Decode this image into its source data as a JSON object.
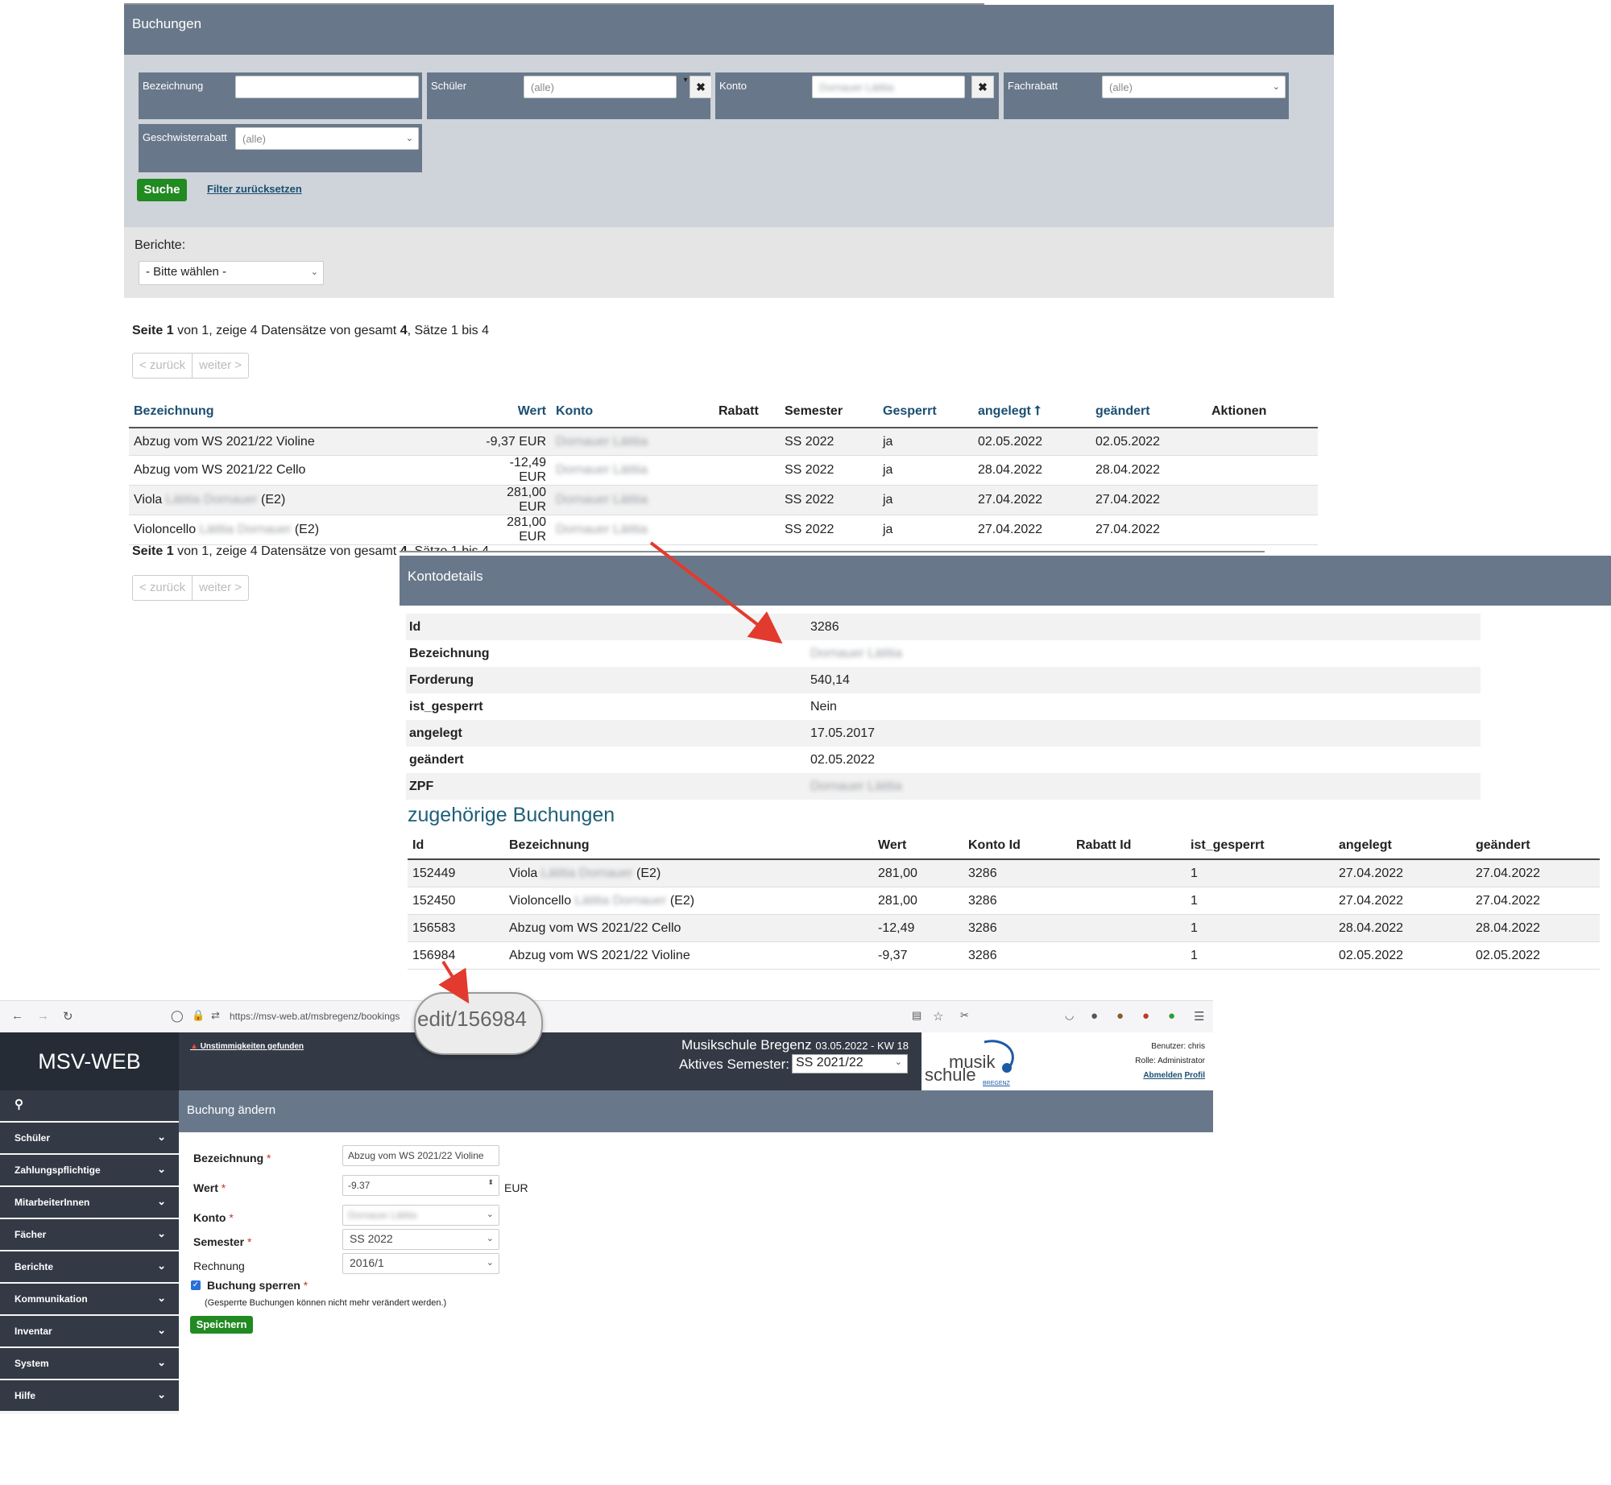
{
  "buchungen": {
    "title": "Buchungen",
    "filters": {
      "bezeichnung_label": "Bezeichnung",
      "schueler_label": "Schüler",
      "schueler_value": "(alle)",
      "konto_label": "Konto",
      "konto_value": "Dornauer Lätitia",
      "fachrabatt_label": "Fachrabatt",
      "fachrabatt_value": "(alle)",
      "geschwisterrabatt_label": "Geschwisterrabatt",
      "geschwisterrabatt_value": "(alle)",
      "search_button": "Suche",
      "reset_link": "Filter zurücksetzen"
    },
    "reports": {
      "label": "Berichte:",
      "select_value": "- Bitte wählen -"
    },
    "pager": {
      "prefix": "Seite",
      "page": "1",
      "middle": "von 1, zeige 4 Datensätze von gesamt",
      "total": "4",
      "suffix": ", Sätze 1 bis 4",
      "prev": "< zurück",
      "next": "weiter >"
    },
    "columns": [
      "Bezeichnung",
      "Wert",
      "Konto",
      "Rabatt",
      "Semester",
      "Gesperrt",
      "angelegt ⭡",
      "geändert",
      "Aktionen"
    ],
    "rows": [
      {
        "bez": "Abzug vom WS 2021/22 Violine",
        "bez_blur": "",
        "bez_suffix": "",
        "wert": "-9,37 EUR",
        "konto": "Dornauer Lätitia",
        "rabatt": "",
        "semester": "SS 2022",
        "gesperrt": "ja",
        "angelegt": "02.05.2022",
        "geaendert": "02.05.2022"
      },
      {
        "bez": "Abzug vom WS 2021/22 Cello",
        "bez_blur": "",
        "bez_suffix": "",
        "wert": "-12,49 EUR",
        "konto": "Dornauer Lätitia",
        "rabatt": "",
        "semester": "SS 2022",
        "gesperrt": "ja",
        "angelegt": "28.04.2022",
        "geaendert": "28.04.2022"
      },
      {
        "bez": "Viola",
        "bez_blur": "Lätitia Dornauer",
        "bez_suffix": "(E2)",
        "wert": "281,00 EUR",
        "konto": "Dornauer Lätitia",
        "rabatt": "",
        "semester": "SS 2022",
        "gesperrt": "ja",
        "angelegt": "27.04.2022",
        "geaendert": "27.04.2022"
      },
      {
        "bez": "Violoncello",
        "bez_blur": "Lätitia Dornauer",
        "bez_suffix": "(E2)",
        "wert": "281,00 EUR",
        "konto": "Dornauer Lätitia",
        "rabatt": "",
        "semester": "SS 2022",
        "gesperrt": "ja",
        "angelegt": "27.04.2022",
        "geaendert": "27.04.2022"
      }
    ]
  },
  "kontodetails": {
    "title": "Kontodetails",
    "fields": [
      {
        "key": "Id",
        "value": "3286"
      },
      {
        "key": "Bezeichnung",
        "value": "Dornauer Lätitia"
      },
      {
        "key": "Forderung",
        "value": "540,14"
      },
      {
        "key": "ist_gesperrt",
        "value": "Nein"
      },
      {
        "key": "angelegt",
        "value": "17.05.2017"
      },
      {
        "key": "geändert",
        "value": "02.05.2022"
      },
      {
        "key": "ZPF",
        "value": "Dornauer Lätitia"
      }
    ],
    "sub_title": "zugehörige Buchungen",
    "columns": [
      "Id",
      "Bezeichnung",
      "Wert",
      "Konto Id",
      "Rabatt Id",
      "ist_gesperrt",
      "angelegt",
      "geändert"
    ],
    "rows": [
      {
        "id": "152449",
        "bez": "Viola",
        "bez_blur": "Lätitia Dornauer",
        "bez_suffix": "(E2)",
        "wert": "281,00",
        "konto_id": "3286",
        "rabatt_id": "",
        "gesperrt": "1",
        "angelegt": "27.04.2022",
        "geaendert": "27.04.2022"
      },
      {
        "id": "152450",
        "bez": "Violoncello",
        "bez_blur": "Lätitia Dornauer",
        "bez_suffix": "(E2)",
        "wert": "281,00",
        "konto_id": "3286",
        "rabatt_id": "",
        "gesperrt": "1",
        "angelegt": "27.04.2022",
        "geaendert": "27.04.2022"
      },
      {
        "id": "156583",
        "bez": "Abzug vom WS 2021/22 Cello",
        "bez_blur": "",
        "bez_suffix": "",
        "wert": "-12,49",
        "konto_id": "3286",
        "rabatt_id": "",
        "gesperrt": "1",
        "angelegt": "28.04.2022",
        "geaendert": "28.04.2022"
      },
      {
        "id": "156984",
        "bez": "Abzug vom WS 2021/22 Violine",
        "bez_blur": "",
        "bez_suffix": "",
        "wert": "-9,37",
        "konto_id": "3286",
        "rabatt_id": "",
        "gesperrt": "1",
        "angelegt": "02.05.2022",
        "geaendert": "02.05.2022"
      }
    ]
  },
  "browser": {
    "url": "https://msv-web.at/msbregenz/bookings",
    "magnified_url": "edit/156984",
    "brand": "MSV-WEB",
    "warning": "Unstimmigkeiten gefunden",
    "school": "Musikschule Bregenz",
    "date_kw": "03.05.2022 - KW 18",
    "active_semester_label": "Aktives Semester:",
    "active_semester_value": "SS 2021/22",
    "logo_text_1": "musik",
    "logo_text_2": "schule",
    "logo_text_3": "BREGENZ",
    "user": "Benutzer: chris",
    "role": "Rolle: Administrator",
    "logout": "Abmelden",
    "profile": "Profil",
    "sidebar": [
      "Schüler",
      "Zahlungspflichtige",
      "MitarbeiterInnen",
      "Fächer",
      "Berichte",
      "Kommunikation",
      "Inventar",
      "System",
      "Hilfe"
    ],
    "form": {
      "title": "Buchung ändern",
      "bezeichnung_label": "Bezeichnung",
      "bezeichnung_value": "Abzug vom WS 2021/22 Violine",
      "wert_label": "Wert",
      "wert_value": "-9.37",
      "wert_unit": "EUR",
      "konto_label": "Konto",
      "konto_value": "Dornauer Lätitia",
      "semester_label": "Semester",
      "semester_value": "SS 2022",
      "rechnung_label": "Rechnung",
      "rechnung_value": "2016/1",
      "sperren_label": "Buchung sperren",
      "sperren_checked": true,
      "sperren_note": "(Gesperrte Buchungen können nicht mehr verändert werden.)",
      "save_button": "Speichern"
    }
  },
  "colors": {
    "header_slate": "#68788a",
    "filter_bg": "#ced4da",
    "accent_green": "#218a21",
    "link_blue": "#1b4f72",
    "arrow_red": "#e23a2e",
    "dark_nav": "#333a45"
  }
}
